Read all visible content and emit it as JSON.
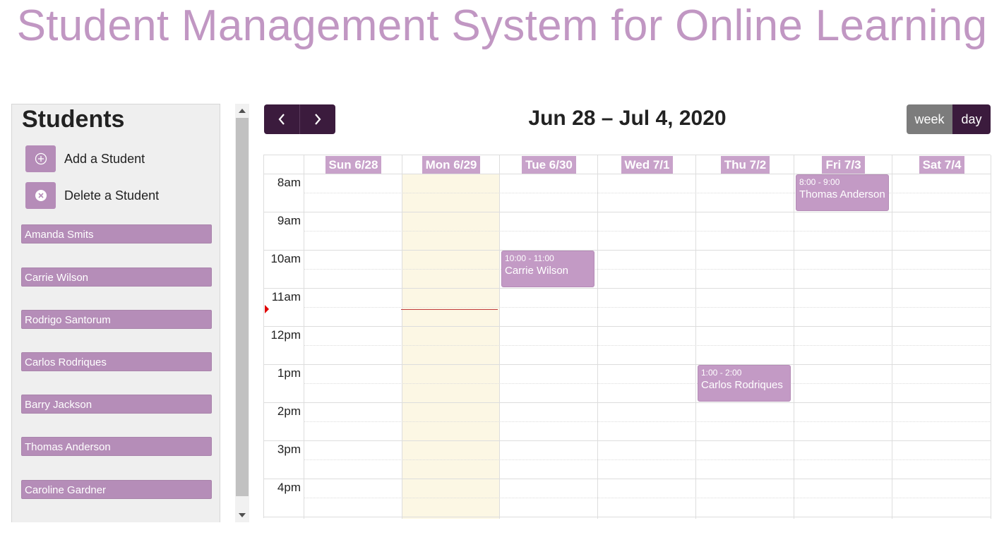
{
  "page": {
    "title": "Student Management System for Online Learning"
  },
  "sidebar": {
    "title": "Students",
    "actions": [
      {
        "label": "Add a Student",
        "icon": "plus-circle-icon"
      },
      {
        "label": "Delete a Student",
        "icon": "x-circle-icon"
      }
    ],
    "students": [
      "Amanda Smits",
      "Carrie Wilson",
      "Rodrigo Santorum",
      "Carlos Rodriques",
      "Barry Jackson",
      "Thomas Anderson",
      "Caroline Gardner"
    ]
  },
  "calendar": {
    "title": "Jun 28 – Jul 4, 2020",
    "prev_icon": "chevron-left-icon",
    "next_icon": "chevron-right-icon",
    "views": {
      "week": "week",
      "day": "day"
    },
    "active_view": "week",
    "today": "Mon 6/29",
    "days": [
      "Sun 6/28",
      "Mon 6/29",
      "Tue 6/30",
      "Wed 7/1",
      "Thu 7/2",
      "Fri 7/3",
      "Sat 7/4"
    ],
    "times": [
      "8am",
      "9am",
      "10am",
      "11am",
      "12pm",
      "1pm",
      "2pm",
      "3pm",
      "4pm"
    ],
    "events": [
      {
        "time": "8:00 - 9:00",
        "title": "Thomas Anderson",
        "day": "Fri 7/3"
      },
      {
        "time": "10:00 - 11:00",
        "title": "Carrie Wilson",
        "day": "Tue 6/30"
      },
      {
        "time": "1:00 - 2:00",
        "title": "Carlos Rodriques",
        "day": "Thu 7/2"
      }
    ]
  },
  "colors": {
    "accent": "#3b1b3d",
    "student_item": "#b58db8",
    "title": "#c197c3",
    "today": "#fcf7e4"
  }
}
